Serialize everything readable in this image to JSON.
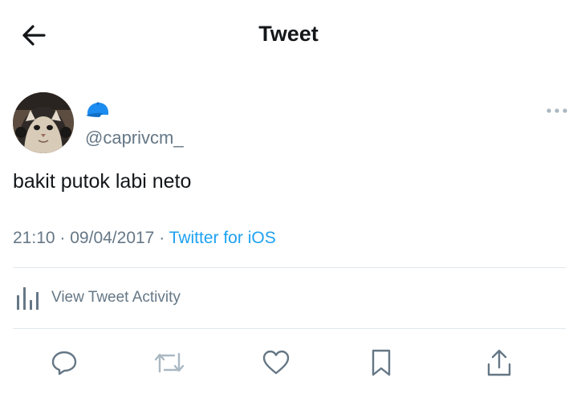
{
  "header": {
    "title": "Tweet"
  },
  "tweet": {
    "handle": "@caprivcm_",
    "text": "bakit putok labi neto",
    "time": "21:10",
    "date": "09/04/2017",
    "separator": "·",
    "source": "Twitter for iOS"
  },
  "activity": {
    "label": "View Tweet Activity"
  },
  "icons": {
    "back": "arrow-left-icon",
    "display_name_emoji": "blue-cap-emoji",
    "more": "more-dots-icon",
    "activity": "bar-chart-icon",
    "reply": "speech-bubble-icon",
    "retweet": "retweet-icon",
    "like": "heart-icon",
    "bookmark": "bookmark-icon",
    "share": "share-icon"
  },
  "colors": {
    "text": "#14171a",
    "secondary": "#657786",
    "link": "#1da1f2",
    "divider": "#e1e8ed",
    "cap": "#1d8cf0",
    "action_icon": "#657786"
  }
}
